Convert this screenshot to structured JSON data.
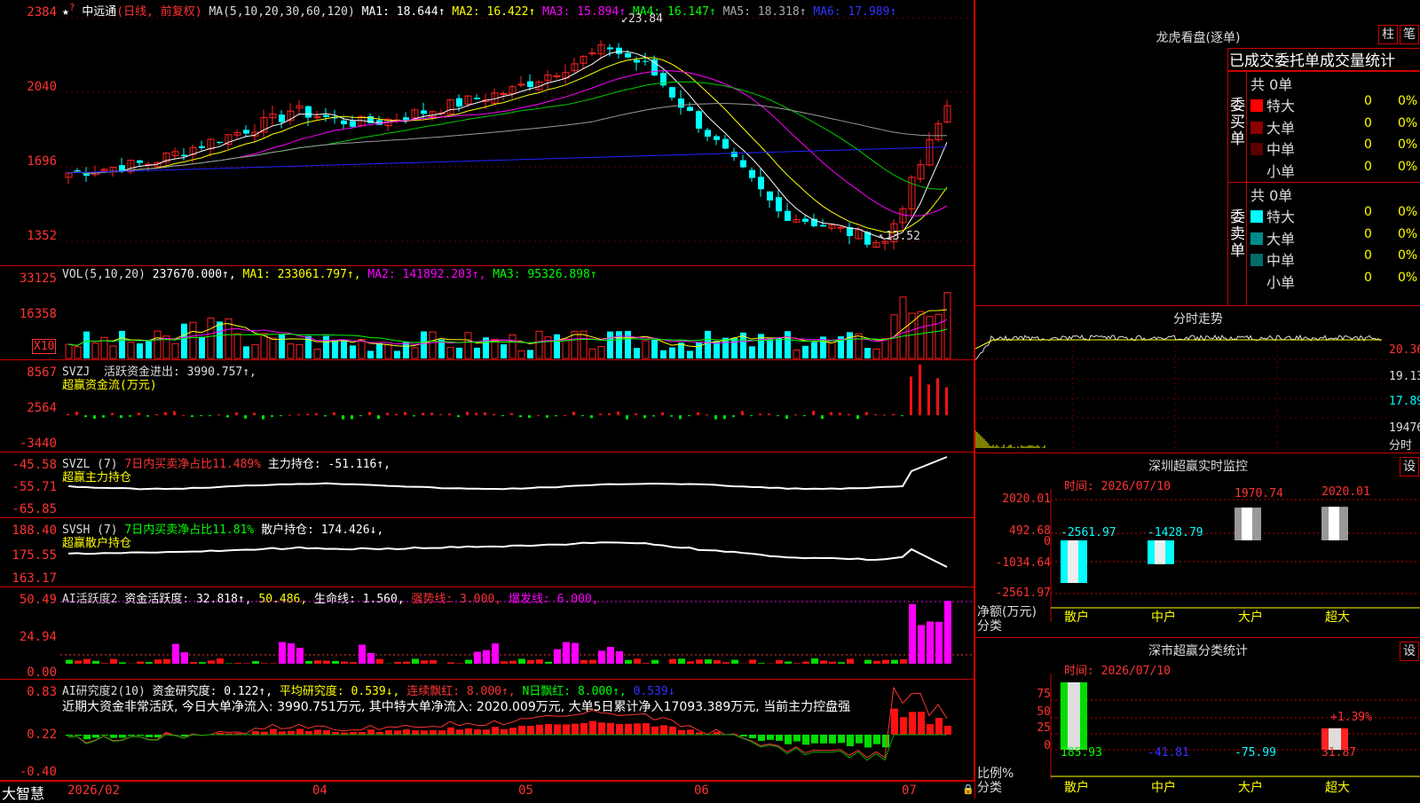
{
  "stock": {
    "name": "中远通",
    "mode": "(日线, 前复权)",
    "ma_label": "MA(5,10,20,30,60,120)",
    "ma1": "MA1: 18.644↑",
    "ma2": "MA2: 16.422↑",
    "ma3": "MA3: 15.894↑",
    "ma4": "MA4: 16.147↑",
    "ma5": "MA5: 18.318↑",
    "ma6": "MA6: 17.989↑",
    "high_label": "23.84",
    "low_label": "13.52",
    "y_ticks": [
      "2384",
      "2040",
      "1696",
      "1352"
    ]
  },
  "vol": {
    "label": "VOL(5,10,20)",
    "value": "237670.000↑,",
    "ma1": "MA1: 233061.797↑,",
    "ma2": "MA2: 141892.203↑,",
    "ma3": "MA3: 95326.898↑",
    "y_ticks": [
      "33125",
      "16358"
    ],
    "unit": "X10"
  },
  "svzj": {
    "label": "SVZJ",
    "title": "活跃资金进出: 3990.757↑,",
    "sub": "超赢资金流(万元)",
    "y_ticks": [
      "8567",
      "2564",
      "-3440"
    ]
  },
  "svzl": {
    "label": "SVZL (7)",
    "t1": "7日内买卖净占比11.489%",
    "t2": "主力持仓: -51.116↑,",
    "sub": "超赢主力持仓",
    "y_ticks": [
      "-45.58",
      "-55.71",
      "-65.85"
    ]
  },
  "svsh": {
    "label": "SVSH (7)",
    "t1": "7日内买卖净占比11.81%",
    "t2": "散户持仓: 174.426↓,",
    "sub": "超赢散户持仓",
    "y_ticks": [
      "188.40",
      "175.55",
      "163.17"
    ]
  },
  "ai1": {
    "label": "AI活跃度2",
    "t1": "资金活跃度: 32.818↑,",
    "t2": "50.486,",
    "t3": "生命线: 1.560,",
    "t4": "强势线: 3.000,",
    "t5": "爆发线: 6.000,",
    "y_ticks": [
      "50.49",
      "24.94",
      "0.00"
    ]
  },
  "ai2": {
    "label": "AI研究度2(10)",
    "t1": "资金研究度: 0.122↑,",
    "t2": "平均研究度: 0.539↓,",
    "t3": "连续飘红: 8.000↑,",
    "t4": "N日飘红: 8.000↑,",
    "t5": "0.539↓",
    "desc": "近期大资金非常活跃, 今日大单净流入: 3990.751万元, 其中特大单净流入: 2020.009万元, 大单5日累计净入17093.389万元, 当前主力控盘强",
    "y_ticks": [
      "0.83",
      "0.22",
      "-0.40"
    ]
  },
  "xaxis": {
    "brand": "大智慧",
    "months": [
      "2026/02",
      "04",
      "05",
      "06",
      "07"
    ]
  },
  "lhb": {
    "title": "龙虎看盘(逐单)",
    "btn1": "柱",
    "btn2": "笔",
    "stat_title": "已成交委托单成交量统计",
    "buy_label": "委买单",
    "sell_label": "委卖单",
    "buy_total": "共 0单",
    "sell_total": "共 0单",
    "buy_rows": [
      {
        "name": "特大",
        "n": "0",
        "p": "0%",
        "color": "#ff0000"
      },
      {
        "name": "大单",
        "n": "0",
        "p": "0%",
        "color": "#8b0000"
      },
      {
        "name": "中单",
        "n": "0",
        "p": "0%",
        "color": "#5a0000"
      },
      {
        "name": "小单",
        "n": "0",
        "p": "0%",
        "color": "#000000"
      }
    ],
    "sell_rows": [
      {
        "name": "特大",
        "n": "0",
        "p": "0%",
        "color": "#00ffff"
      },
      {
        "name": "大单",
        "n": "0",
        "p": "0%",
        "color": "#008b8b"
      },
      {
        "name": "中单",
        "n": "0",
        "p": "0%",
        "color": "#006b6b"
      },
      {
        "name": "小单",
        "n": "0",
        "p": "0%",
        "color": "#000000"
      }
    ]
  },
  "intraday": {
    "title": "分时走势",
    "ticks": [
      "20.36",
      "19.13",
      "17.89",
      "19476",
      "分时"
    ]
  },
  "monitor": {
    "title": "深圳超赢实时监控",
    "btn": "设",
    "time": "时间: 2026/07/10",
    "y_ticks": [
      "2020.01",
      "492.68",
      "0",
      "-1034.64",
      "-2561.97"
    ],
    "y_label": "净额(万元)",
    "x_label": "分类",
    "categories": [
      "散户",
      "中户",
      "大户",
      "超大"
    ],
    "values": [
      -2561.97,
      -1428.79,
      1970.74,
      2020.01
    ],
    "value_labels": [
      "-2561.97",
      "-1428.79",
      "1970.74",
      "2020.01"
    ]
  },
  "classify": {
    "title": "深市超赢分类统计",
    "btn": "设",
    "time": "时间: 2026/07/10",
    "y_ticks": [
      "75",
      "50",
      "25",
      "0"
    ],
    "y_label": "比例%",
    "x_label": "分类",
    "categories": [
      "散户",
      "中户",
      "大户",
      "超大"
    ],
    "values": [
      185.93,
      -41.81,
      -75.99,
      31.87
    ],
    "value_labels": [
      "185.93",
      "-41.81",
      "-75.99",
      "31.87"
    ],
    "extra_label": "+1.39%"
  },
  "colors": {
    "up": "#ff2020",
    "down": "#00ffff",
    "grid": "#c00000",
    "yellow": "#ffff00",
    "magenta": "#ff00ff",
    "green": "#00ff00"
  }
}
